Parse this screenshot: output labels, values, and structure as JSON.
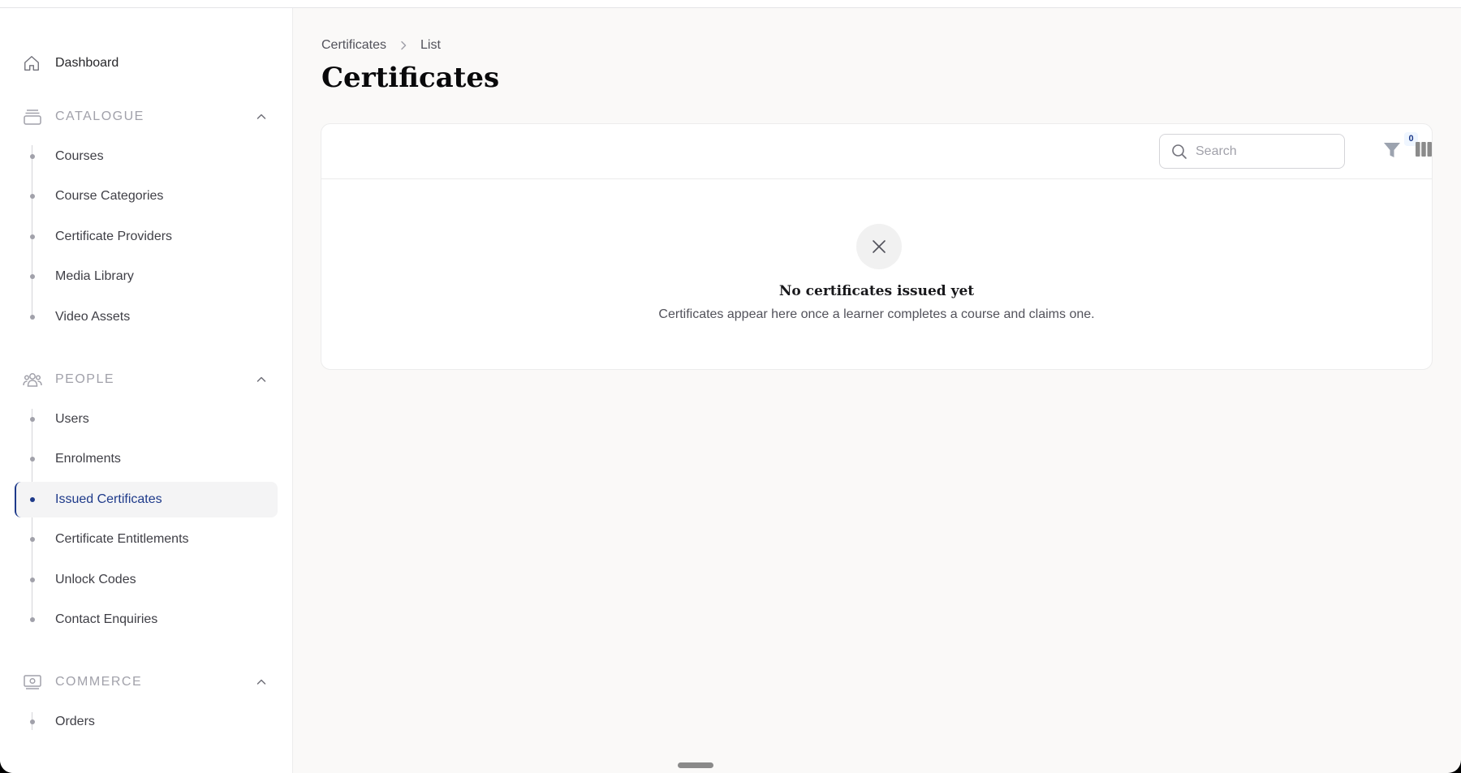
{
  "sidebar": {
    "dashboard": "Dashboard",
    "groups": [
      {
        "label": "CATALOGUE",
        "items": [
          "Courses",
          "Course Categories",
          "Certificate Providers",
          "Media Library",
          "Video Assets"
        ]
      },
      {
        "label": "PEOPLE",
        "items": [
          "Users",
          "Enrolments",
          "Issued Certificates",
          "Certificate Entitlements",
          "Unlock Codes",
          "Contact Enquiries"
        ],
        "active": "Issued Certificates"
      },
      {
        "label": "COMMERCE",
        "items": [
          "Orders"
        ]
      }
    ]
  },
  "breadcrumb": {
    "root": "Certificates",
    "current": "List"
  },
  "page": {
    "title": "Certificates"
  },
  "toolbar": {
    "search_placeholder": "Search",
    "filter_count": "0"
  },
  "empty_state": {
    "title": "No certificates issued yet",
    "description": "Certificates appear here once a learner completes a course and claims one."
  },
  "colors": {
    "accent": "#1e3a8a",
    "muted": "#a1a1aa"
  },
  "icons": {
    "dashboard": "home-icon",
    "catalogue": "archive-icon",
    "people": "users-icon",
    "commerce": "banknote-icon"
  }
}
